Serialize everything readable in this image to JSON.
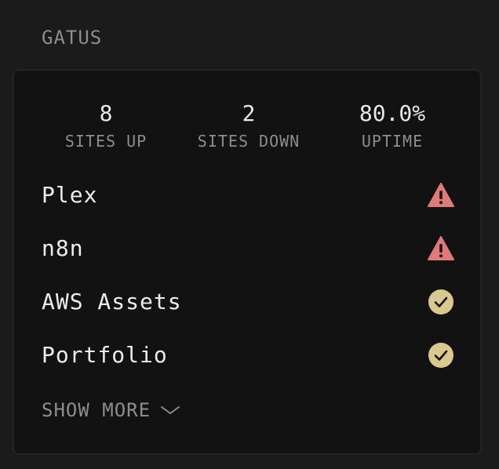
{
  "widget": {
    "title": "GATUS"
  },
  "stats": [
    {
      "value": "8",
      "label": "SITES UP"
    },
    {
      "value": "2",
      "label": "SITES DOWN"
    },
    {
      "value": "80.0%",
      "label": "UPTIME"
    }
  ],
  "sites": [
    {
      "name": "Plex",
      "status": "down",
      "icon": "warning-icon"
    },
    {
      "name": "n8n",
      "status": "down",
      "icon": "warning-icon"
    },
    {
      "name": "AWS Assets",
      "status": "up",
      "icon": "check-circle-icon"
    },
    {
      "name": "Portfolio",
      "status": "up",
      "icon": "check-circle-icon"
    }
  ],
  "show_more": {
    "label": "SHOW MORE",
    "icon": "chevron-down-icon"
  },
  "colors": {
    "down": "#e07a7a",
    "up": "#d9c88f",
    "muted": "#8d8d8d"
  }
}
